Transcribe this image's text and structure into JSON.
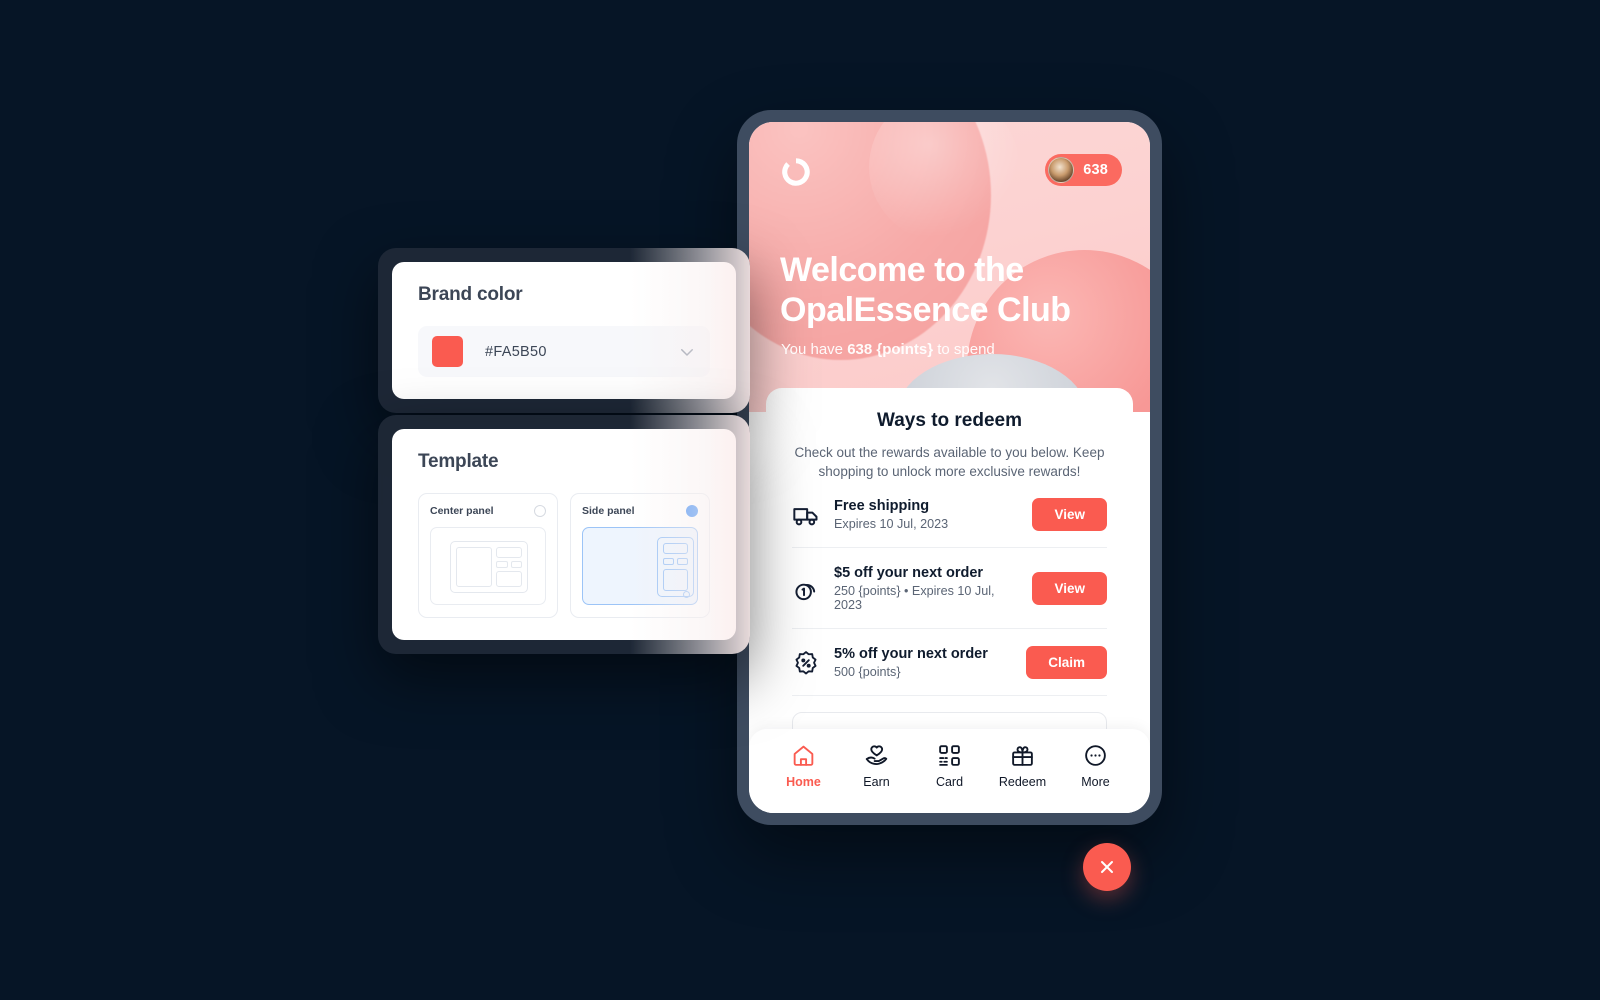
{
  "theme": {
    "background": "#061526",
    "brand_color": "#FA5B50",
    "device_frame": "#3E4C60",
    "accent_blue": "#4A93F5"
  },
  "brand_panel": {
    "heading": "Brand color",
    "color_value": "#FA5B50",
    "swatch_color": "#FA5B50",
    "chevron_icon": "chevron-down-icon"
  },
  "template_panel": {
    "heading": "Template",
    "options": [
      {
        "label": "Center panel",
        "selected": false
      },
      {
        "label": "Side panel",
        "selected": true
      }
    ]
  },
  "phone": {
    "hero": {
      "logo_icon": "opal-ring-logo-icon",
      "points_badge": {
        "avatar_icon": "user-avatar",
        "points": "638"
      },
      "title": "Welcome to the OpalEssence Club",
      "subtitle_prefix": "You have ",
      "subtitle_points": "638 {points}",
      "subtitle_suffix": " to spend"
    },
    "sheet": {
      "title": "Ways to redeem",
      "description": "Check out the rewards available to you below. Keep shopping to unlock more exclusive rewards!",
      "rewards": [
        {
          "icon": "truck-icon",
          "name": "Free shipping",
          "meta": "Expires 10 Jul, 2023",
          "action": "View"
        },
        {
          "icon": "coin-dollar-icon",
          "name": "$5 off your next order",
          "meta": "250 {points} • Expires 10 Jul, 2023",
          "action": "View"
        },
        {
          "icon": "percent-badge-icon",
          "name": "5% off your next order",
          "meta": "500 {points}",
          "action": "Claim"
        }
      ]
    },
    "tabbar": [
      {
        "icon": "home-icon",
        "label": "Home",
        "active": true
      },
      {
        "icon": "earn-icon",
        "label": "Earn",
        "active": false
      },
      {
        "icon": "qr-card-icon",
        "label": "Card",
        "active": false
      },
      {
        "icon": "gift-icon",
        "label": "Redeem",
        "active": false
      },
      {
        "icon": "more-icon",
        "label": "More",
        "active": false
      }
    ]
  },
  "close_button": {
    "icon": "close-icon"
  }
}
